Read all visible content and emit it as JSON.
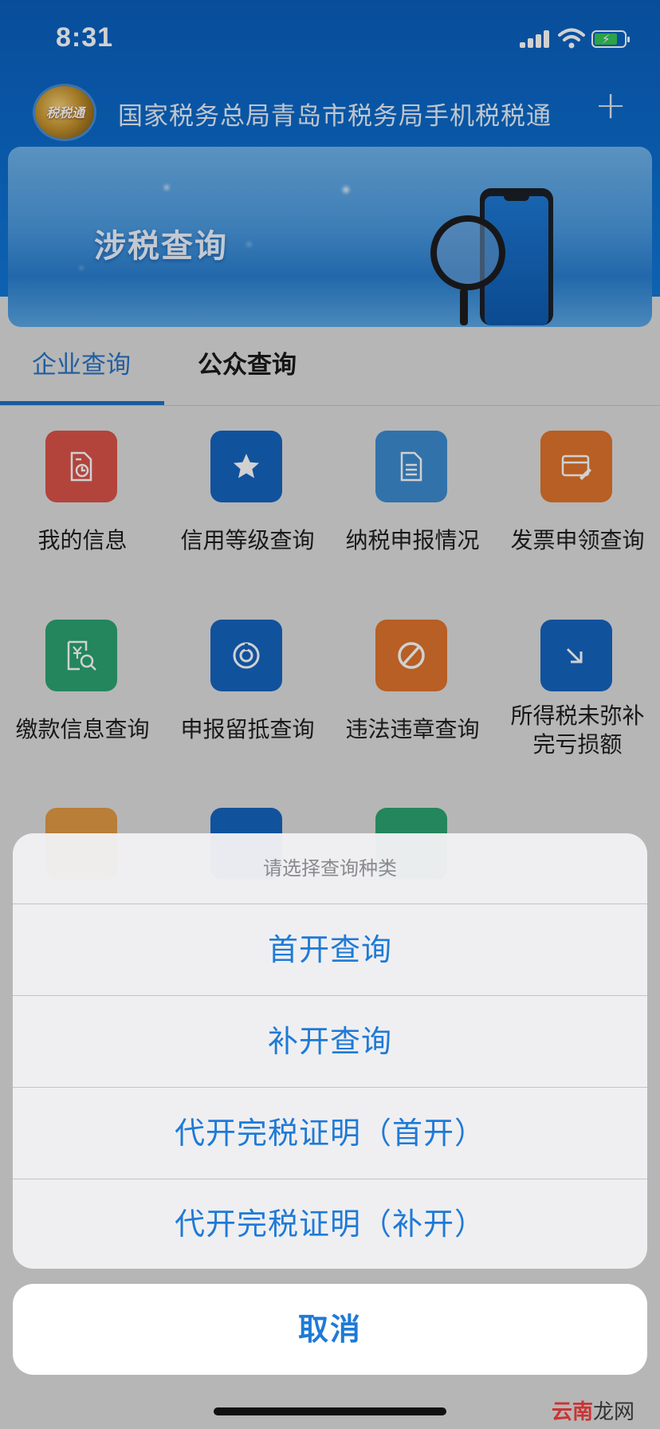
{
  "status_bar": {
    "time": "8:31"
  },
  "header": {
    "logo_text": "税税通",
    "title": "国家税务总局青岛市税务局手机税税通",
    "add_symbol": "+"
  },
  "banner": {
    "title": "涉税查询"
  },
  "tabs": [
    {
      "label": "企业查询",
      "active": true
    },
    {
      "label": "公众查询",
      "active": false
    }
  ],
  "grid": {
    "row1": [
      {
        "label": "我的信息",
        "icon": "document-clock-icon",
        "color": "#d9534a"
      },
      {
        "label": "信用等级查询",
        "icon": "star-icon",
        "color": "#1565c0"
      },
      {
        "label": "纳税申报情况",
        "icon": "list-document-icon",
        "color": "#3d8bd1"
      },
      {
        "label": "发票申领查询",
        "icon": "invoice-pen-icon",
        "color": "#e0752d"
      }
    ],
    "row2": [
      {
        "label": "缴款信息查询",
        "icon": "yuan-search-icon",
        "color": "#2ba472"
      },
      {
        "label": "申报留抵查询",
        "icon": "pie-chart-icon",
        "color": "#1565c0"
      },
      {
        "label": "违法违章查询",
        "icon": "prohibited-icon",
        "color": "#e0752d"
      },
      {
        "label": "所得税未弥补完亏损额",
        "label_line1": "所得税未弥补",
        "label_line2": "完亏损额",
        "icon": "arrow-down-right-icon",
        "color": "#1565c0"
      }
    ],
    "row3_colors": [
      "#e29a44",
      "#1565c0",
      "#2ba472"
    ]
  },
  "action_sheet": {
    "title": "请选择查询种类",
    "options": [
      "首开查询",
      "补开查询",
      "代开完税证明（首开）",
      "代开完税证明（补开）"
    ],
    "cancel": "取消"
  },
  "watermark": {
    "red": "云南",
    "dark": "龙网"
  }
}
